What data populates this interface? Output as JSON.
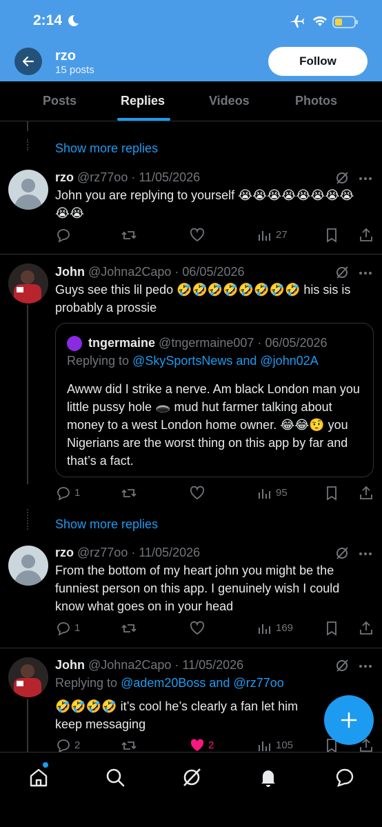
{
  "status_bar": {
    "time": "2:14"
  },
  "header": {
    "name": "rzo",
    "posts_count": "15 posts",
    "follow_label": "Follow"
  },
  "tabs": [
    {
      "label": "Posts"
    },
    {
      "label": "Replies"
    },
    {
      "label": "Videos"
    },
    {
      "label": "Photos"
    }
  ],
  "feed": {
    "show_more_1": "Show more replies",
    "post1": {
      "name": "rzo",
      "handle": "@rz77oo",
      "date": "11/05/2026",
      "text": "John you are replying to yourself 😭😭😭😭😭😭😭😭😭😭",
      "views": "27"
    },
    "post2": {
      "name": "John",
      "handle": "@Johna2Capo",
      "date": "06/05/2026",
      "text": "Guys see this lil pedo 🤣🤣🤣🤣🤣🤣🤣🤣 his sis is probably a prossie",
      "replies": "1",
      "views": "95",
      "quote": {
        "name": "tngermaine",
        "handle": "@tngermaine007",
        "date": "06/05/2026",
        "replying_prefix": "Replying to ",
        "replying_to": "@SkySportsNews and @john02A",
        "text": "Awww did I strike a nerve. Am black London man you little pussy hole 🕳️ mud hut farmer talking about money to a west London home owner. 😂😂🤨 you Nigerians are the worst thing on this app by far and that’s a fact."
      }
    },
    "show_more_2": "Show more replies",
    "post3": {
      "name": "rzo",
      "handle": "@rz77oo",
      "date": "11/05/2026",
      "text": "From the bottom of my heart john you might be the funniest person on this app. I genuinely wish I could know what goes on in your head",
      "replies": "1",
      "views": "169"
    },
    "post4": {
      "name": "John",
      "handle": "@Johna2Capo",
      "date": "11/05/2026",
      "replying_prefix": "Replying to ",
      "replying_to": "@adem20Boss and @rz77oo",
      "text": "🤣🤣🤣🤣 it’s cool he’s clearly a fan let him keep messaging",
      "replies": "2",
      "likes": "2",
      "views": "105"
    }
  },
  "colors": {
    "accent": "#1d9bf0",
    "header_bg": "#4b9ce8",
    "like": "#f91880"
  },
  "icons": [
    "back-arrow-icon",
    "reply-icon",
    "repost-icon",
    "like-icon",
    "views-icon",
    "bookmark-icon",
    "share-icon",
    "grok-icon",
    "more-icon",
    "compose-icon",
    "home-icon",
    "search-icon",
    "notifications-icon",
    "messages-icon"
  ]
}
